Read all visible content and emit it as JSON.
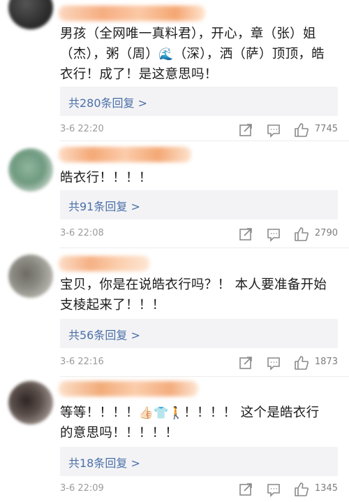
{
  "comments": [
    {
      "text_parts": [
        "男孩（全网唯一真料君），开心，章（张）姐（杰），粥（周）",
        "🌊",
        "（深），洒（萨）顶顶，皓衣行！成了！是这意思吗！"
      ],
      "replies": "共280条回复 >",
      "time": "3-6 22:20",
      "likes": "7745",
      "avatar_color": "#3a3a3a",
      "name_color": "#f6a574"
    },
    {
      "text_parts": [
        "皓衣行！！！！"
      ],
      "replies": "共91条回复 >",
      "time": "3-6 22:08",
      "likes": "2790",
      "avatar_color": "#6f9a80",
      "name_color": "#f4a069"
    },
    {
      "text_parts": [
        "宝贝，你是在说皓衣行吗？！ 本人要准备开始支棱起来了！！！"
      ],
      "replies": "共56条回复 >",
      "time": "3-6 22:16",
      "likes": "1873",
      "avatar_color": "#8c8c84",
      "name_color": "#f5a877"
    },
    {
      "text_parts": [
        "等等！！！！",
        "👍🏻👕🚶",
        "！！！！ 这个是皓衣行的意思吗！！！！！"
      ],
      "replies": "共18条回复 >",
      "time": "3-6 22:09",
      "likes": "1345",
      "avatar_color": "#5a4e4a",
      "name_color": "#f1a36c"
    }
  ],
  "icons": [
    "share-icon",
    "comment-icon",
    "like-icon"
  ]
}
